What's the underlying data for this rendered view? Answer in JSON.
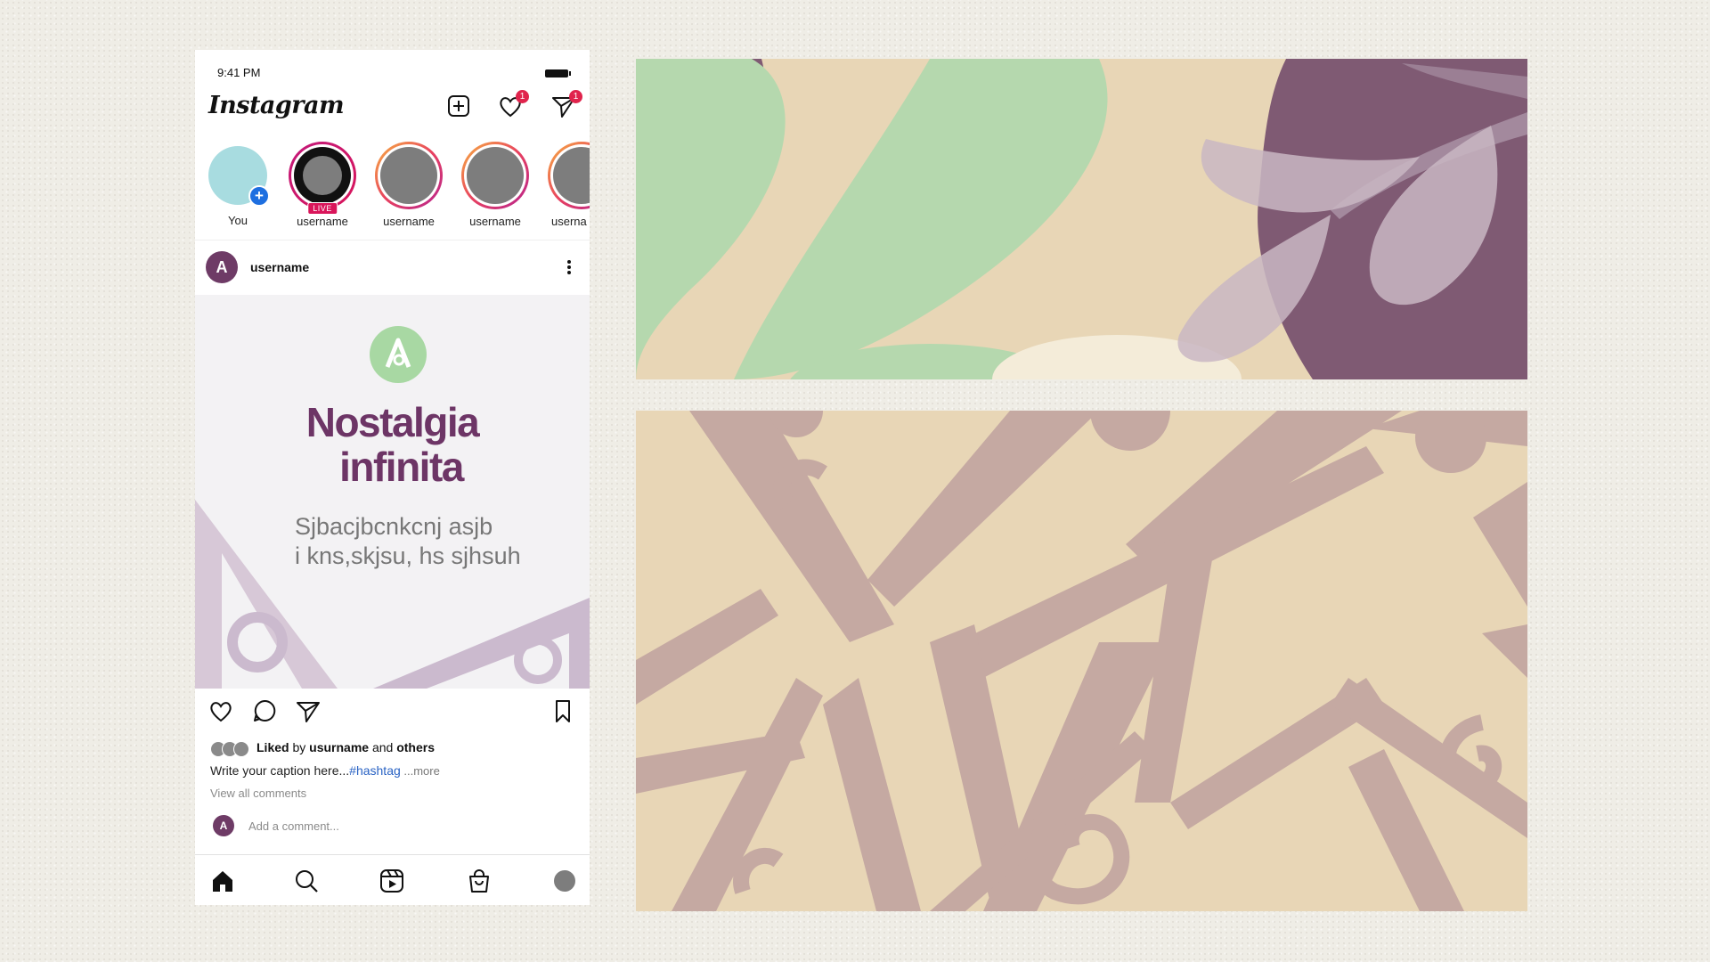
{
  "phone": {
    "status_time": "9:41 PM",
    "app_name": "Instagram",
    "header_icons": [
      "new-post-icon",
      "heart-icon",
      "direct-message-icon"
    ],
    "notifications": {
      "likes_count": "1",
      "messages_count": "1"
    },
    "stories": [
      {
        "label": "You",
        "type": "own",
        "color": "#a8dce0"
      },
      {
        "label": "username",
        "type": "live",
        "live_label": "LIVE"
      },
      {
        "label": "username",
        "type": "story"
      },
      {
        "label": "username",
        "type": "story"
      },
      {
        "label": "userna",
        "type": "story"
      }
    ],
    "post": {
      "username": "username",
      "avatar_letter": "A",
      "title_line1": "Nostalgia",
      "title_line2": "infinita",
      "subtitle_line1": "Sjbacjbcnkcnj asjb",
      "subtitle_line2": "i kns,skjsu, hs sjhsuh",
      "liked_word": "Liked",
      "liked_by": "by",
      "liked_user": "usurname",
      "liked_and": "and",
      "liked_others": "others",
      "caption": "Write your caption here...",
      "hashtag": "#hashtag",
      "more": " ...more",
      "view_comments": "View all comments",
      "add_comment_placeholder": "Add a comment..."
    },
    "bottom_nav": [
      "home-icon",
      "search-icon",
      "reels-icon",
      "shop-icon",
      "profile-icon"
    ]
  },
  "colors": {
    "brand_purple": "#6d3566",
    "logo_green": "#a8d8a3",
    "banner_beige": "#e8d6b6",
    "banner_green": "#b5d8ae",
    "banner_plum": "#7f5a73",
    "pattern_mauve": "#bfa3a2",
    "notification_red": "#e0234c",
    "hashtag_blue": "#2a63c4"
  }
}
